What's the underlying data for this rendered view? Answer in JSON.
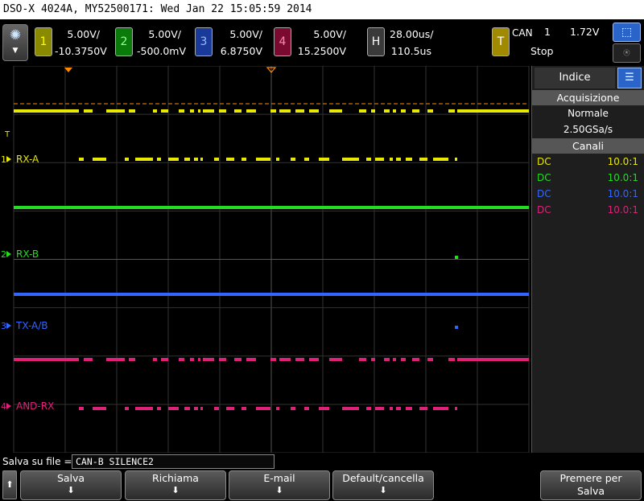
{
  "title_bar": {
    "text": "DSO-X 4024A, MY52500171: Wed Jan 22 15:05:59 2014"
  },
  "channels": [
    {
      "num": "1",
      "scale": "5.00V/",
      "offset": "-10.3750V",
      "color": "#e8e800"
    },
    {
      "num": "2",
      "scale": "5.00V/",
      "offset": "-500.0mV",
      "color": "#22dd22"
    },
    {
      "num": "3",
      "scale": "5.00V/",
      "offset": "6.8750V",
      "color": "#3366ff"
    },
    {
      "num": "4",
      "scale": "5.00V/",
      "offset": "15.2500V",
      "color": "#e0207a"
    }
  ],
  "horizontal": {
    "badge": "H",
    "scale": "28.00us/",
    "delay": "110.5us"
  },
  "trigger": {
    "badge": "T",
    "source_label": "CAN",
    "channel": "1",
    "level": "1.72V",
    "status": "Stop"
  },
  "waveforms": {
    "ch1_label": "RX-A",
    "ch2_label": "RX-B",
    "ch3_label": "TX-A/B",
    "ch4_label": "AND-RX",
    "ch1_marker": "1",
    "ch2_marker": "2",
    "ch3_marker": "3",
    "ch4_marker": "4",
    "trigger_marker": "T"
  },
  "side_panel": {
    "tab": "Indice",
    "acq_header": "Acquisizione",
    "acq_mode": "Normale",
    "sample_rate": "2.50GSa/s",
    "channels_header": "Canali",
    "channel_rows": [
      {
        "coupling": "DC",
        "probe": "10.0:1",
        "color": "#e8e800"
      },
      {
        "coupling": "DC",
        "probe": "10.0:1",
        "color": "#22dd22"
      },
      {
        "coupling": "DC",
        "probe": "10.0:1",
        "color": "#3366ff"
      },
      {
        "coupling": "DC",
        "probe": "10.0:1",
        "color": "#e0207a"
      }
    ]
  },
  "bottom": {
    "save_to_file_label": "Salva su file =",
    "filename": "CAN-B SILENCE2",
    "softkeys": [
      "Salva",
      "Richiama",
      "E-mail",
      "Default/cancella"
    ],
    "press_to_save_line1": "Premere per",
    "press_to_save_line2": "Salva"
  }
}
